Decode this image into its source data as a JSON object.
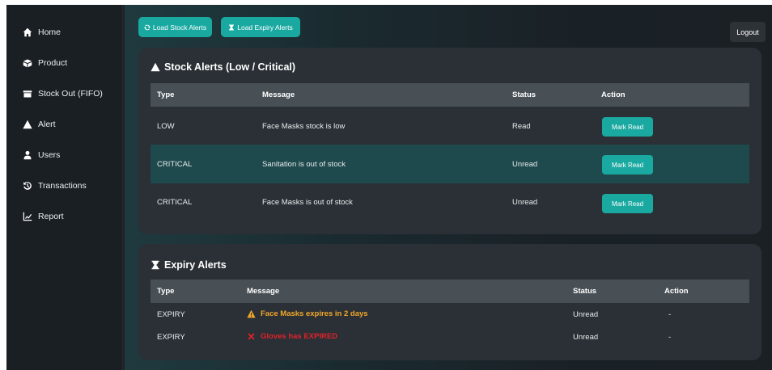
{
  "sidebar": {
    "items": [
      {
        "label": "Home",
        "icon": "home-icon"
      },
      {
        "label": "Product",
        "icon": "product-icon"
      },
      {
        "label": "Stock Out (FIFO)",
        "icon": "stock-out-icon"
      },
      {
        "label": "Alert",
        "icon": "alert-icon"
      },
      {
        "label": "Users",
        "icon": "users-icon"
      },
      {
        "label": "Transactions",
        "icon": "history-icon"
      },
      {
        "label": "Report",
        "icon": "chart-line-icon"
      }
    ]
  },
  "toolbar": {
    "load_stock_label": "Load Stock Alerts",
    "load_expiry_label": "Load Expiry Alerts",
    "logout_label": "Logout"
  },
  "stock_alerts": {
    "title": "Stock Alerts (Low / Critical)",
    "headers": [
      "Type",
      "Message",
      "Status",
      "Action"
    ],
    "rows": [
      {
        "type": "LOW",
        "message": "Face Masks stock is low",
        "status": "Read",
        "action": "Mark Read"
      },
      {
        "type": "CRITICAL",
        "message": "Sanitation is out of stock",
        "status": "Unread",
        "action": "Mark Read"
      },
      {
        "type": "CRITICAL",
        "message": "Face Masks is out of stock",
        "status": "Unread",
        "action": "Mark Read"
      }
    ]
  },
  "expiry_alerts": {
    "title": "Expiry Alerts",
    "headers": [
      "Type",
      "Message",
      "Status",
      "Action"
    ],
    "rows": [
      {
        "type": "EXPIRY",
        "message": "Face Masks expires in 2 days",
        "status": "Unread",
        "action": "-",
        "level": "warning"
      },
      {
        "type": "EXPIRY",
        "message": "Gloves has EXPIRED",
        "status": "Unread",
        "action": "-",
        "level": "expired"
      }
    ]
  },
  "colors": {
    "accent": "#1aa9a1",
    "warning": "#f3a72b",
    "danger": "#e0222c",
    "highlight_row": "#1f4a4d"
  }
}
